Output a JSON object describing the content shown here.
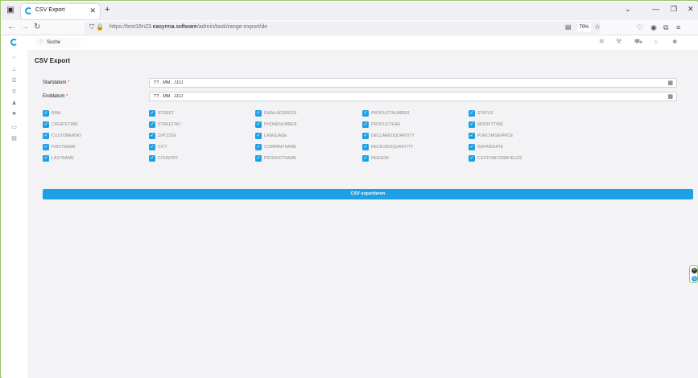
{
  "browser": {
    "tab_title": "CSV Export",
    "tab_close": "✕",
    "new_tab": "+",
    "url_prefix": "https://test16n23.",
    "url_domain": "easyrma.software",
    "url_path": "/admin/task/range-export/de",
    "zoom": "70%",
    "window_controls": [
      "⌄",
      "—",
      "❐",
      "✕"
    ]
  },
  "app": {
    "search_placeholder": "Suche",
    "page_title": "CSV Export",
    "start_date": {
      "label": "Startdatum",
      "required": "*",
      "value": "TT . MM . JJJJ"
    },
    "end_date": {
      "label": "Enddatum",
      "required": "*",
      "value": "TT . MM . JJJJ"
    },
    "checkbox_columns": [
      [
        "RMA",
        "CREATETIME",
        "CUSTOMERNO",
        "FIRSTNAME",
        "LASTNAME"
      ],
      [
        "STREET",
        "STREETNO",
        "ZIPCODE",
        "CITY",
        "COUNTRY"
      ],
      [
        "EMAILADDRESS",
        "PHONENUMBER",
        "LANGUAGE",
        "COMPANYNAME",
        "PRODUCTNAME"
      ],
      [
        "PRODUCTNUMBER",
        "PRODUCTEAN",
        "DECLAREDQUANTITY",
        "RECEIVEDQUANTITY",
        "REASON"
      ],
      [
        "STATUS",
        "MODIFYTIME",
        "PURCHASEPRICE",
        "REPAIRDATE",
        "CUSTOMFORMFIELDS"
      ]
    ],
    "export_button": "CSV exportieren",
    "accent_color": "#1ea0e6"
  }
}
